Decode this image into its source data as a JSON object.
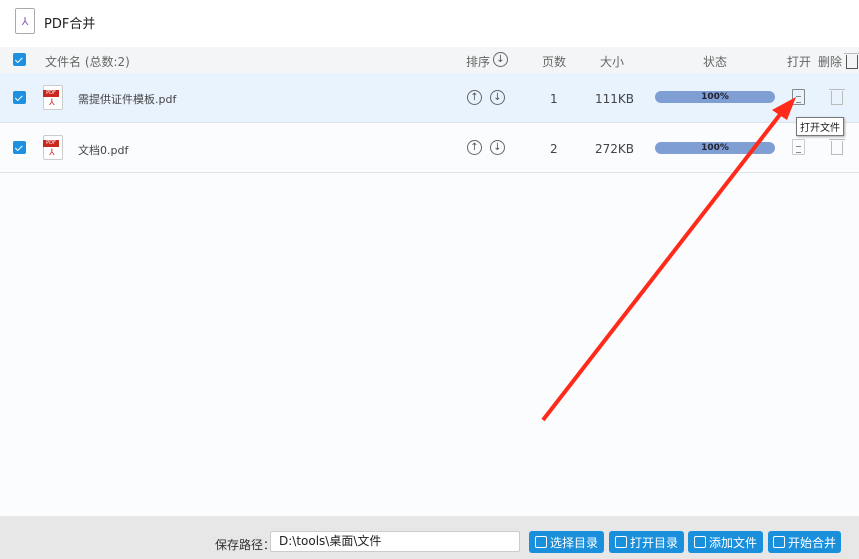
{
  "app": {
    "title": "PDF合并"
  },
  "header": {
    "filename": "文件名 (总数:2)",
    "sort": "排序",
    "pages": "页数",
    "size": "大小",
    "status": "状态",
    "open": "打开",
    "delete": "删除"
  },
  "files": [
    {
      "name": "需提供证件模板.pdf",
      "pages": "1",
      "size": "111KB",
      "progress": "100%"
    },
    {
      "name": "文档0.pdf",
      "pages": "2",
      "size": "272KB",
      "progress": "100%"
    }
  ],
  "tooltip": "打开文件",
  "footer": {
    "save_label": "保存路径：",
    "save_path": "D:\\tools\\桌面\\文件",
    "choose_dir": "选择目录",
    "open_dir": "打开目录",
    "add_file": "添加文件",
    "start_merge": "开始合并"
  },
  "colors": {
    "accent": "#1a8fdc",
    "progress": "#7f9fd4",
    "arrow": "#ff2a1a"
  }
}
